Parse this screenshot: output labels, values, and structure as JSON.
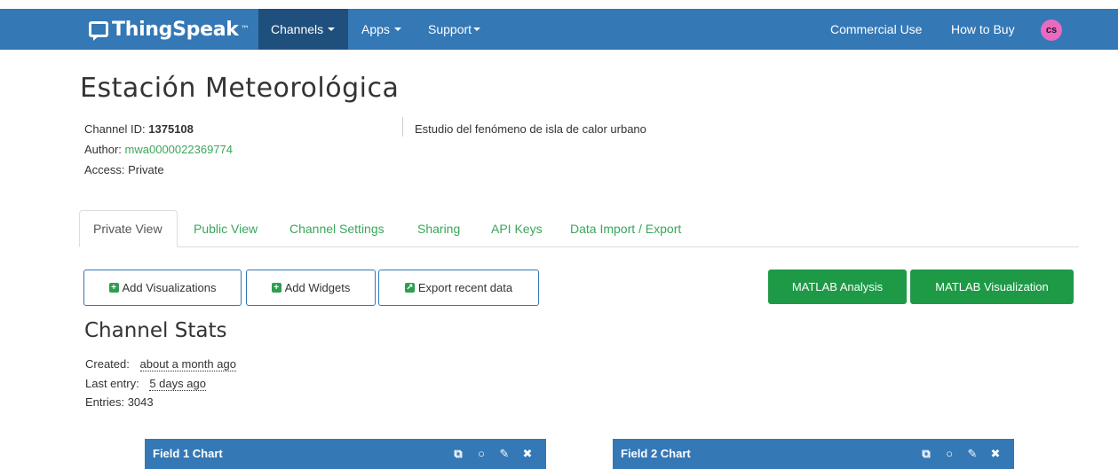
{
  "navbar": {
    "brand": "ThingSpeak",
    "trademark": "™",
    "items": [
      {
        "label": "Channels",
        "active": true
      },
      {
        "label": "Apps"
      },
      {
        "label": "Support"
      }
    ],
    "right_items": [
      {
        "label": "Commercial Use"
      },
      {
        "label": "How to Buy"
      }
    ],
    "avatar_initials": "cs"
  },
  "channel": {
    "title": "Estación Meteorológica",
    "id_label": "Channel ID:",
    "id_value": "1375108",
    "author_label": "Author:",
    "author_value": "mwa0000022369774",
    "access_label": "Access:",
    "access_value": "Private",
    "description": "Estudio del fenómeno de isla de calor urbano"
  },
  "tabs": [
    {
      "label": "Private View",
      "active": true
    },
    {
      "label": "Public View"
    },
    {
      "label": "Channel Settings"
    },
    {
      "label": "Sharing"
    },
    {
      "label": "API Keys"
    },
    {
      "label": "Data Import / Export"
    }
  ],
  "actions": {
    "add_visualizations": "Add Visualizations",
    "add_widgets": "Add Widgets",
    "export_recent": "Export recent data",
    "matlab_analysis": "MATLAB Analysis",
    "matlab_visualization": "MATLAB Visualization"
  },
  "stats": {
    "title": "Channel Stats",
    "created_label": "Created:",
    "created_value": "about a month ago",
    "last_entry_label": "Last entry:",
    "last_entry_value": "5 days ago",
    "entries_label": "Entries:",
    "entries_value": "3043"
  },
  "charts": [
    {
      "title": "Field 1 Chart"
    },
    {
      "title": "Field 2 Chart"
    }
  ],
  "colors": {
    "navbar": "#3478b6",
    "navbar_active": "#1f4f7c",
    "link_green": "#3aa65b",
    "button_green": "#1e9a46",
    "avatar": "#e86bbf"
  }
}
